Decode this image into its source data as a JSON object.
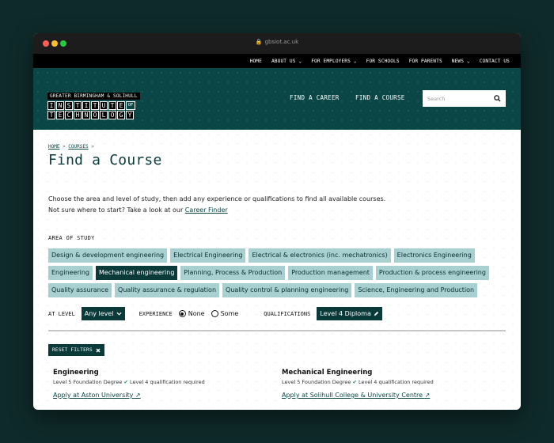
{
  "browser": {
    "url": "gbsiot.ac.uk"
  },
  "topnav": [
    "HOME",
    "ABOUT US ⌄",
    "FOR EMPLOYERS ⌄",
    "FOR SCHOOLS",
    "FOR PARENTS",
    "NEWS ⌄",
    "CONTACT US"
  ],
  "logo": {
    "top": "GREATER BIRMINGHAM & SOLIHULL",
    "row1": [
      "I",
      "N",
      "S",
      "T",
      "I",
      "T",
      "U",
      "T",
      "E",
      "OF"
    ],
    "row2": [
      "T",
      "E",
      "C",
      "H",
      "N",
      "O",
      "L",
      "O",
      "G",
      "Y"
    ]
  },
  "hero": {
    "find_career": "FIND A CAREER",
    "find_course": "FIND A COURSE",
    "search_placeholder": "Search"
  },
  "breadcrumb": {
    "home": "HOME",
    "sep1": " > ",
    "courses": "COURSES",
    "sep2": " >"
  },
  "page_title": "Find a Course",
  "intro": {
    "line1": "Choose the area and level of study, then add any experience or qualifications to find all available courses.",
    "line2_prefix": "Not sure where to start? Take a look at our ",
    "line2_link": "Career Finder"
  },
  "area_label": "AREA OF STUDY",
  "areas": [
    "Design & development engineering",
    "Electrical Engineering",
    "Electrical & electronics (inc. mechatronics)",
    "Electronics Engineering",
    "Engineering",
    "Mechanical engineering",
    "Planning, Process & Production",
    "Production management",
    "Production & process engineering",
    "Quality assurance",
    "Quality assurance & regulation",
    "Quality control & planning engineering",
    "Science, Engineering and Production"
  ],
  "filters": {
    "level_label": "AT LEVEL",
    "level_value": "Any level",
    "experience_label": "EXPERIENCE",
    "exp_none": "None",
    "exp_some": "Some",
    "qual_label": "QUALIFICATIONS",
    "qual_value": "Level 4 Diploma"
  },
  "reset_label": "RESET FILTERS",
  "results": [
    {
      "title": "Engineering",
      "level": "Level 5 Foundation Degree",
      "req": "Level 4 qualification required",
      "apply": "Apply at Aston University"
    },
    {
      "title": "Mechanical Engineering",
      "level": "Level 5 Foundation Degree",
      "req": "Level 4 qualification required",
      "apply": "Apply at Solihull College & University Centre"
    }
  ]
}
